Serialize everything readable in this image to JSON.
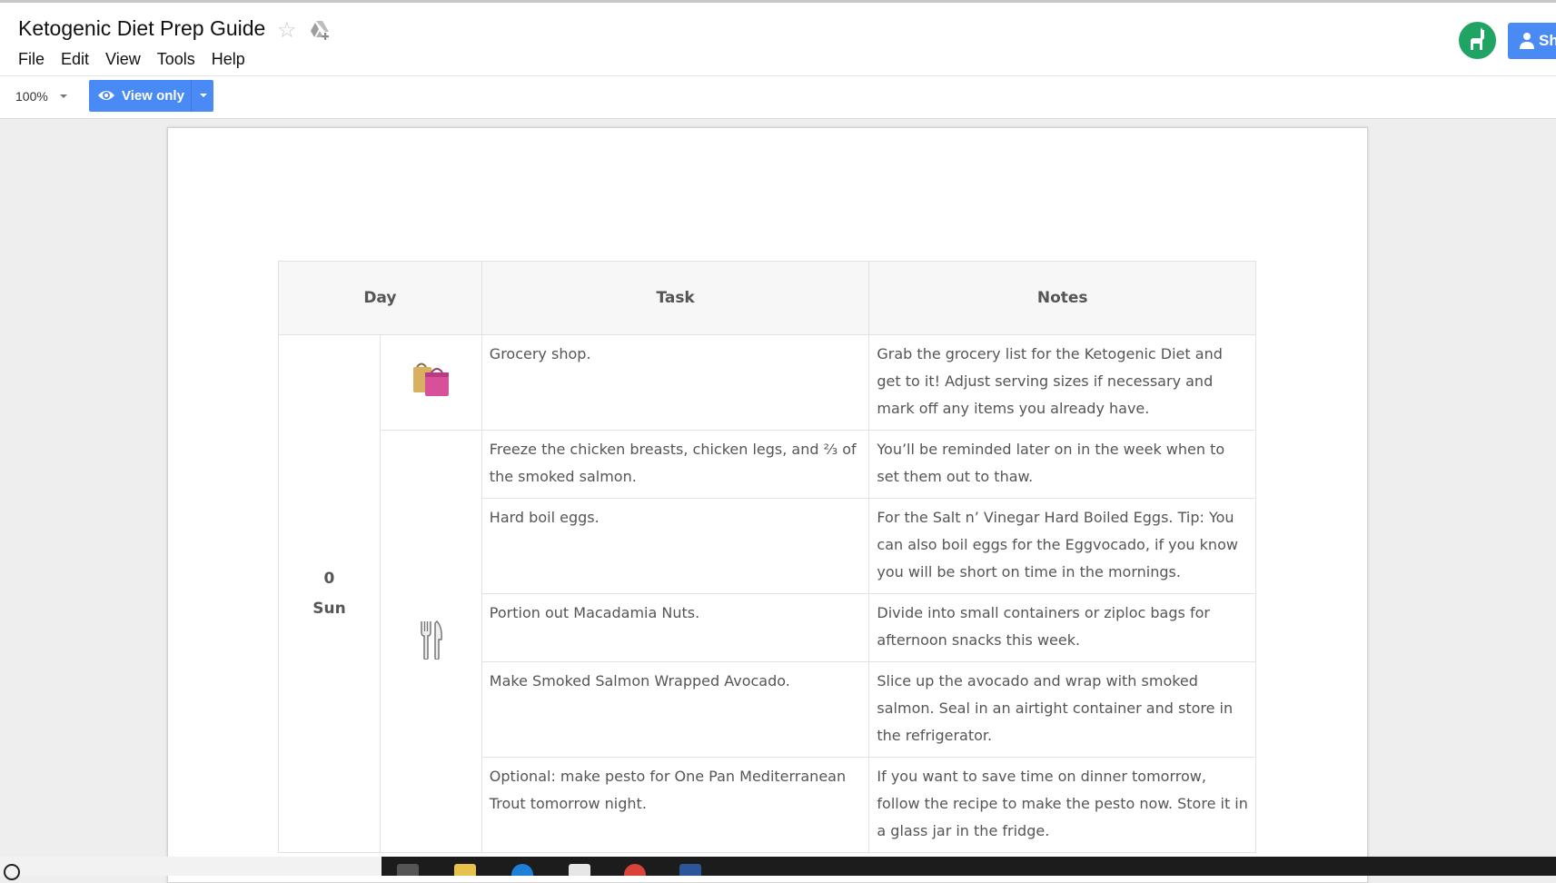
{
  "window": {
    "title": "Ketogenic Diet Prep Guide",
    "menu": [
      "File",
      "Edit",
      "View",
      "Tools",
      "Help"
    ],
    "share_label": "Sh"
  },
  "toolbar": {
    "zoom": "100%",
    "view_only_label": "View only"
  },
  "table": {
    "headers": {
      "day": "Day",
      "task": "Task",
      "notes": "Notes"
    },
    "day": {
      "number": "0",
      "name": "Sun"
    },
    "rows": [
      {
        "task": "Grocery shop.",
        "notes": "Grab the grocery list for the Ketogenic Diet and get to it! Adjust serving sizes if necessary and mark off any items you already have."
      },
      {
        "task": "Freeze the chicken breasts, chicken legs, and ⅔ of the smoked salmon.",
        "notes": "You’ll be reminded later on in the week when to set them out to thaw."
      },
      {
        "task": "Hard boil eggs.",
        "notes": "For the Salt n’ Vinegar Hard Boiled Eggs. Tip: You can also boil eggs for the Eggvocado, if you know you will be short on time in the mornings."
      },
      {
        "task": "Portion out Macadamia Nuts.",
        "notes": "Divide into small containers or ziploc bags for afternoon snacks this week."
      },
      {
        "task": "Make Smoked Salmon Wrapped Avocado.",
        "notes": "Slice up the avocado and wrap with smoked salmon. Seal in an airtight container and store in the refrigerator."
      },
      {
        "task": "Optional: make pesto for One Pan Mediterranean Trout tomorrow night.",
        "notes": "If you want to save time on dinner tomorrow, follow the recipe to make the pesto now. Store it in a glass jar in the fridge."
      }
    ]
  },
  "icons": {
    "shopping": "shopping-bags-icon",
    "prep": "fork-and-knife-icon",
    "star": "star-icon",
    "drive": "add-to-drive-icon",
    "eye": "eye-icon"
  },
  "colors": {
    "accent": "#4a8af4",
    "avatar": "#1fa463"
  }
}
